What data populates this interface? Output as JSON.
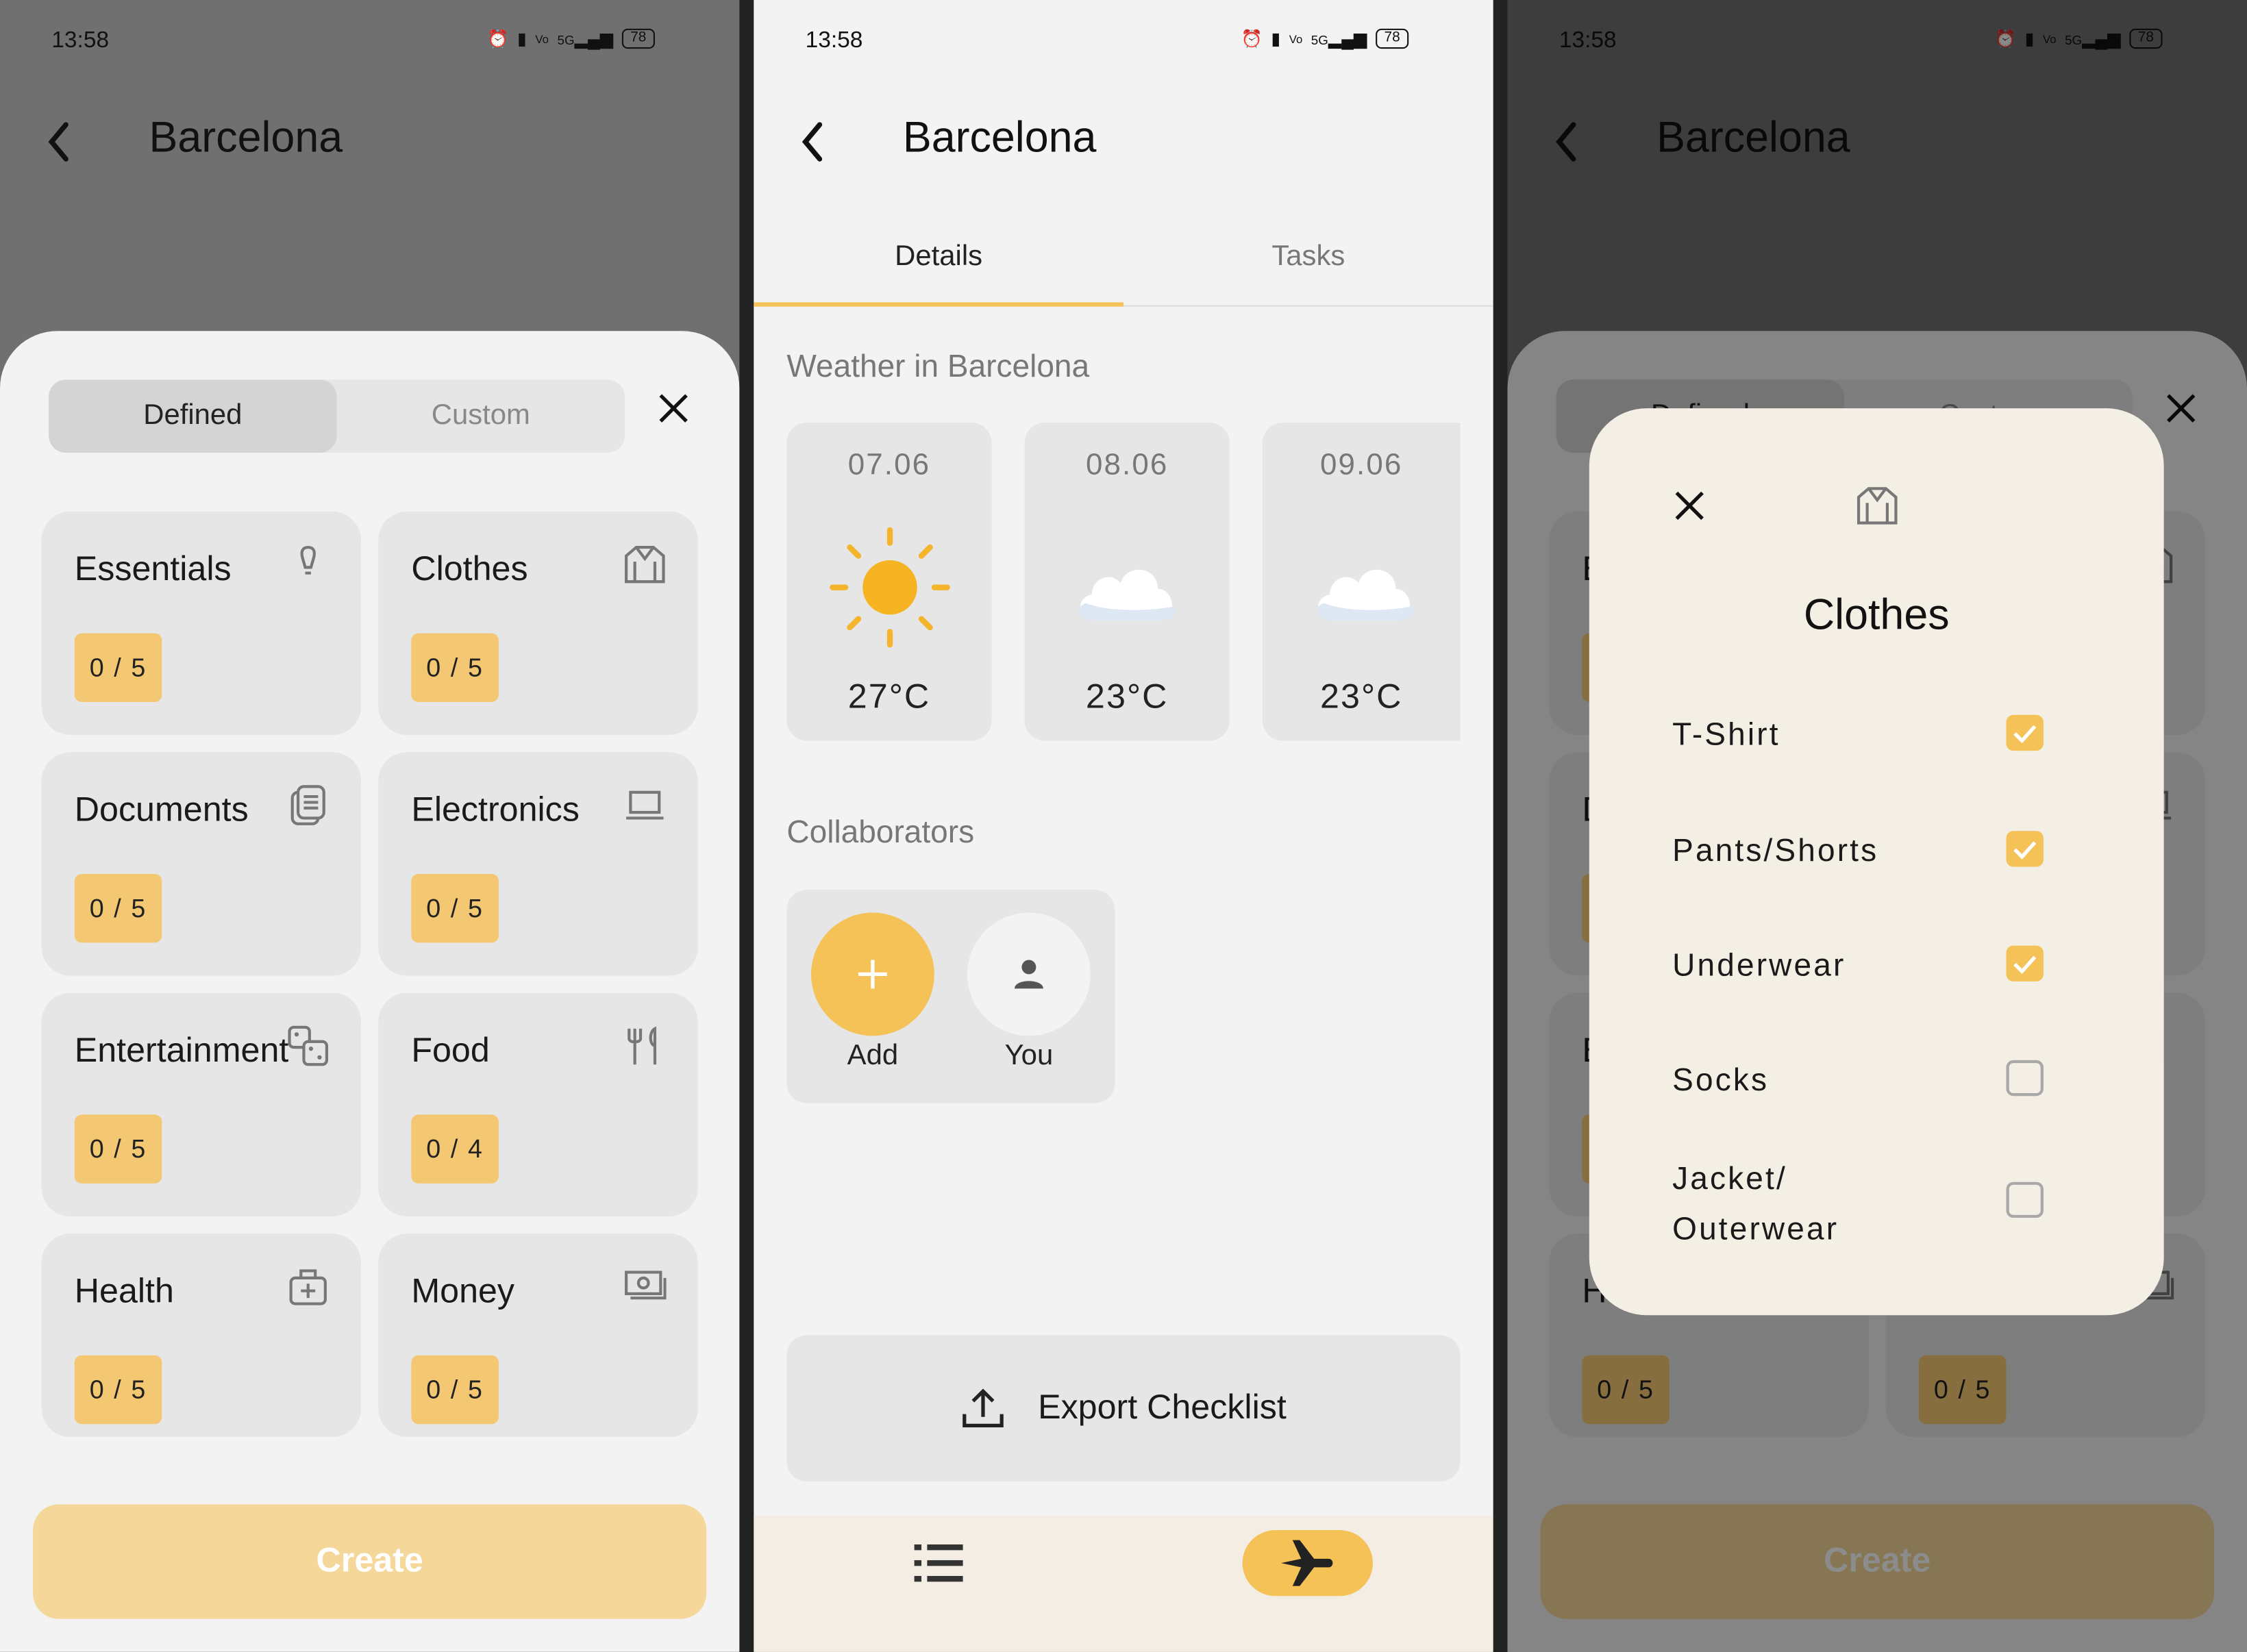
{
  "status_bar": {
    "time": "13:58",
    "network": "5G",
    "battery": "78"
  },
  "header": {
    "title": "Barcelona"
  },
  "sheet": {
    "tabs": [
      {
        "label": "Defined",
        "selected": true
      },
      {
        "label": "Custom",
        "selected": false
      }
    ],
    "categories": [
      {
        "name": "Essentials",
        "icon": "lightbulb-icon",
        "progress": "0 / 5"
      },
      {
        "name": "Clothes",
        "icon": "shirt-icon",
        "progress": "0 / 5"
      },
      {
        "name": "Documents",
        "icon": "document-icon",
        "progress": "0 / 5"
      },
      {
        "name": "Electronics",
        "icon": "laptop-icon",
        "progress": "0 / 5"
      },
      {
        "name": "Entertainment",
        "icon": "dice-icon",
        "progress": "0 / 5"
      },
      {
        "name": "Food",
        "icon": "utensils-icon",
        "progress": "0 / 4"
      },
      {
        "name": "Health",
        "icon": "first-aid-icon",
        "progress": "0 / 5"
      },
      {
        "name": "Money",
        "icon": "banknote-icon",
        "progress": "0 / 5"
      }
    ],
    "create_label": "Create"
  },
  "details": {
    "tabs": [
      {
        "label": "Details",
        "selected": true
      },
      {
        "label": "Tasks",
        "selected": false
      }
    ],
    "weather_heading": "Weather in Barcelona",
    "weather": [
      {
        "date": "07.06",
        "icon": "sun-icon",
        "temp": "27°C"
      },
      {
        "date": "08.06",
        "icon": "cloud-icon",
        "temp": "23°C"
      },
      {
        "date": "09.06",
        "icon": "cloud-icon",
        "temp": "23°C"
      }
    ],
    "collaborators_heading": "Collaborators",
    "collaborators": [
      {
        "label": "Add"
      },
      {
        "label": "You"
      }
    ],
    "export_label": "Export Checklist"
  },
  "dialog": {
    "title": "Clothes",
    "items": [
      {
        "label": "T-Shirt",
        "checked": true
      },
      {
        "label": "Pants/Shorts",
        "checked": true
      },
      {
        "label": "Underwear",
        "checked": true
      },
      {
        "label": "Socks",
        "checked": false
      },
      {
        "label": "Jacket/\nOuterwear",
        "checked": false
      }
    ]
  },
  "colors": {
    "accent": "#f4c257",
    "badge": "#f4c872",
    "create_button": "#f5d79a",
    "card": "#e6e6e6",
    "dialog": "#f4efe4"
  }
}
